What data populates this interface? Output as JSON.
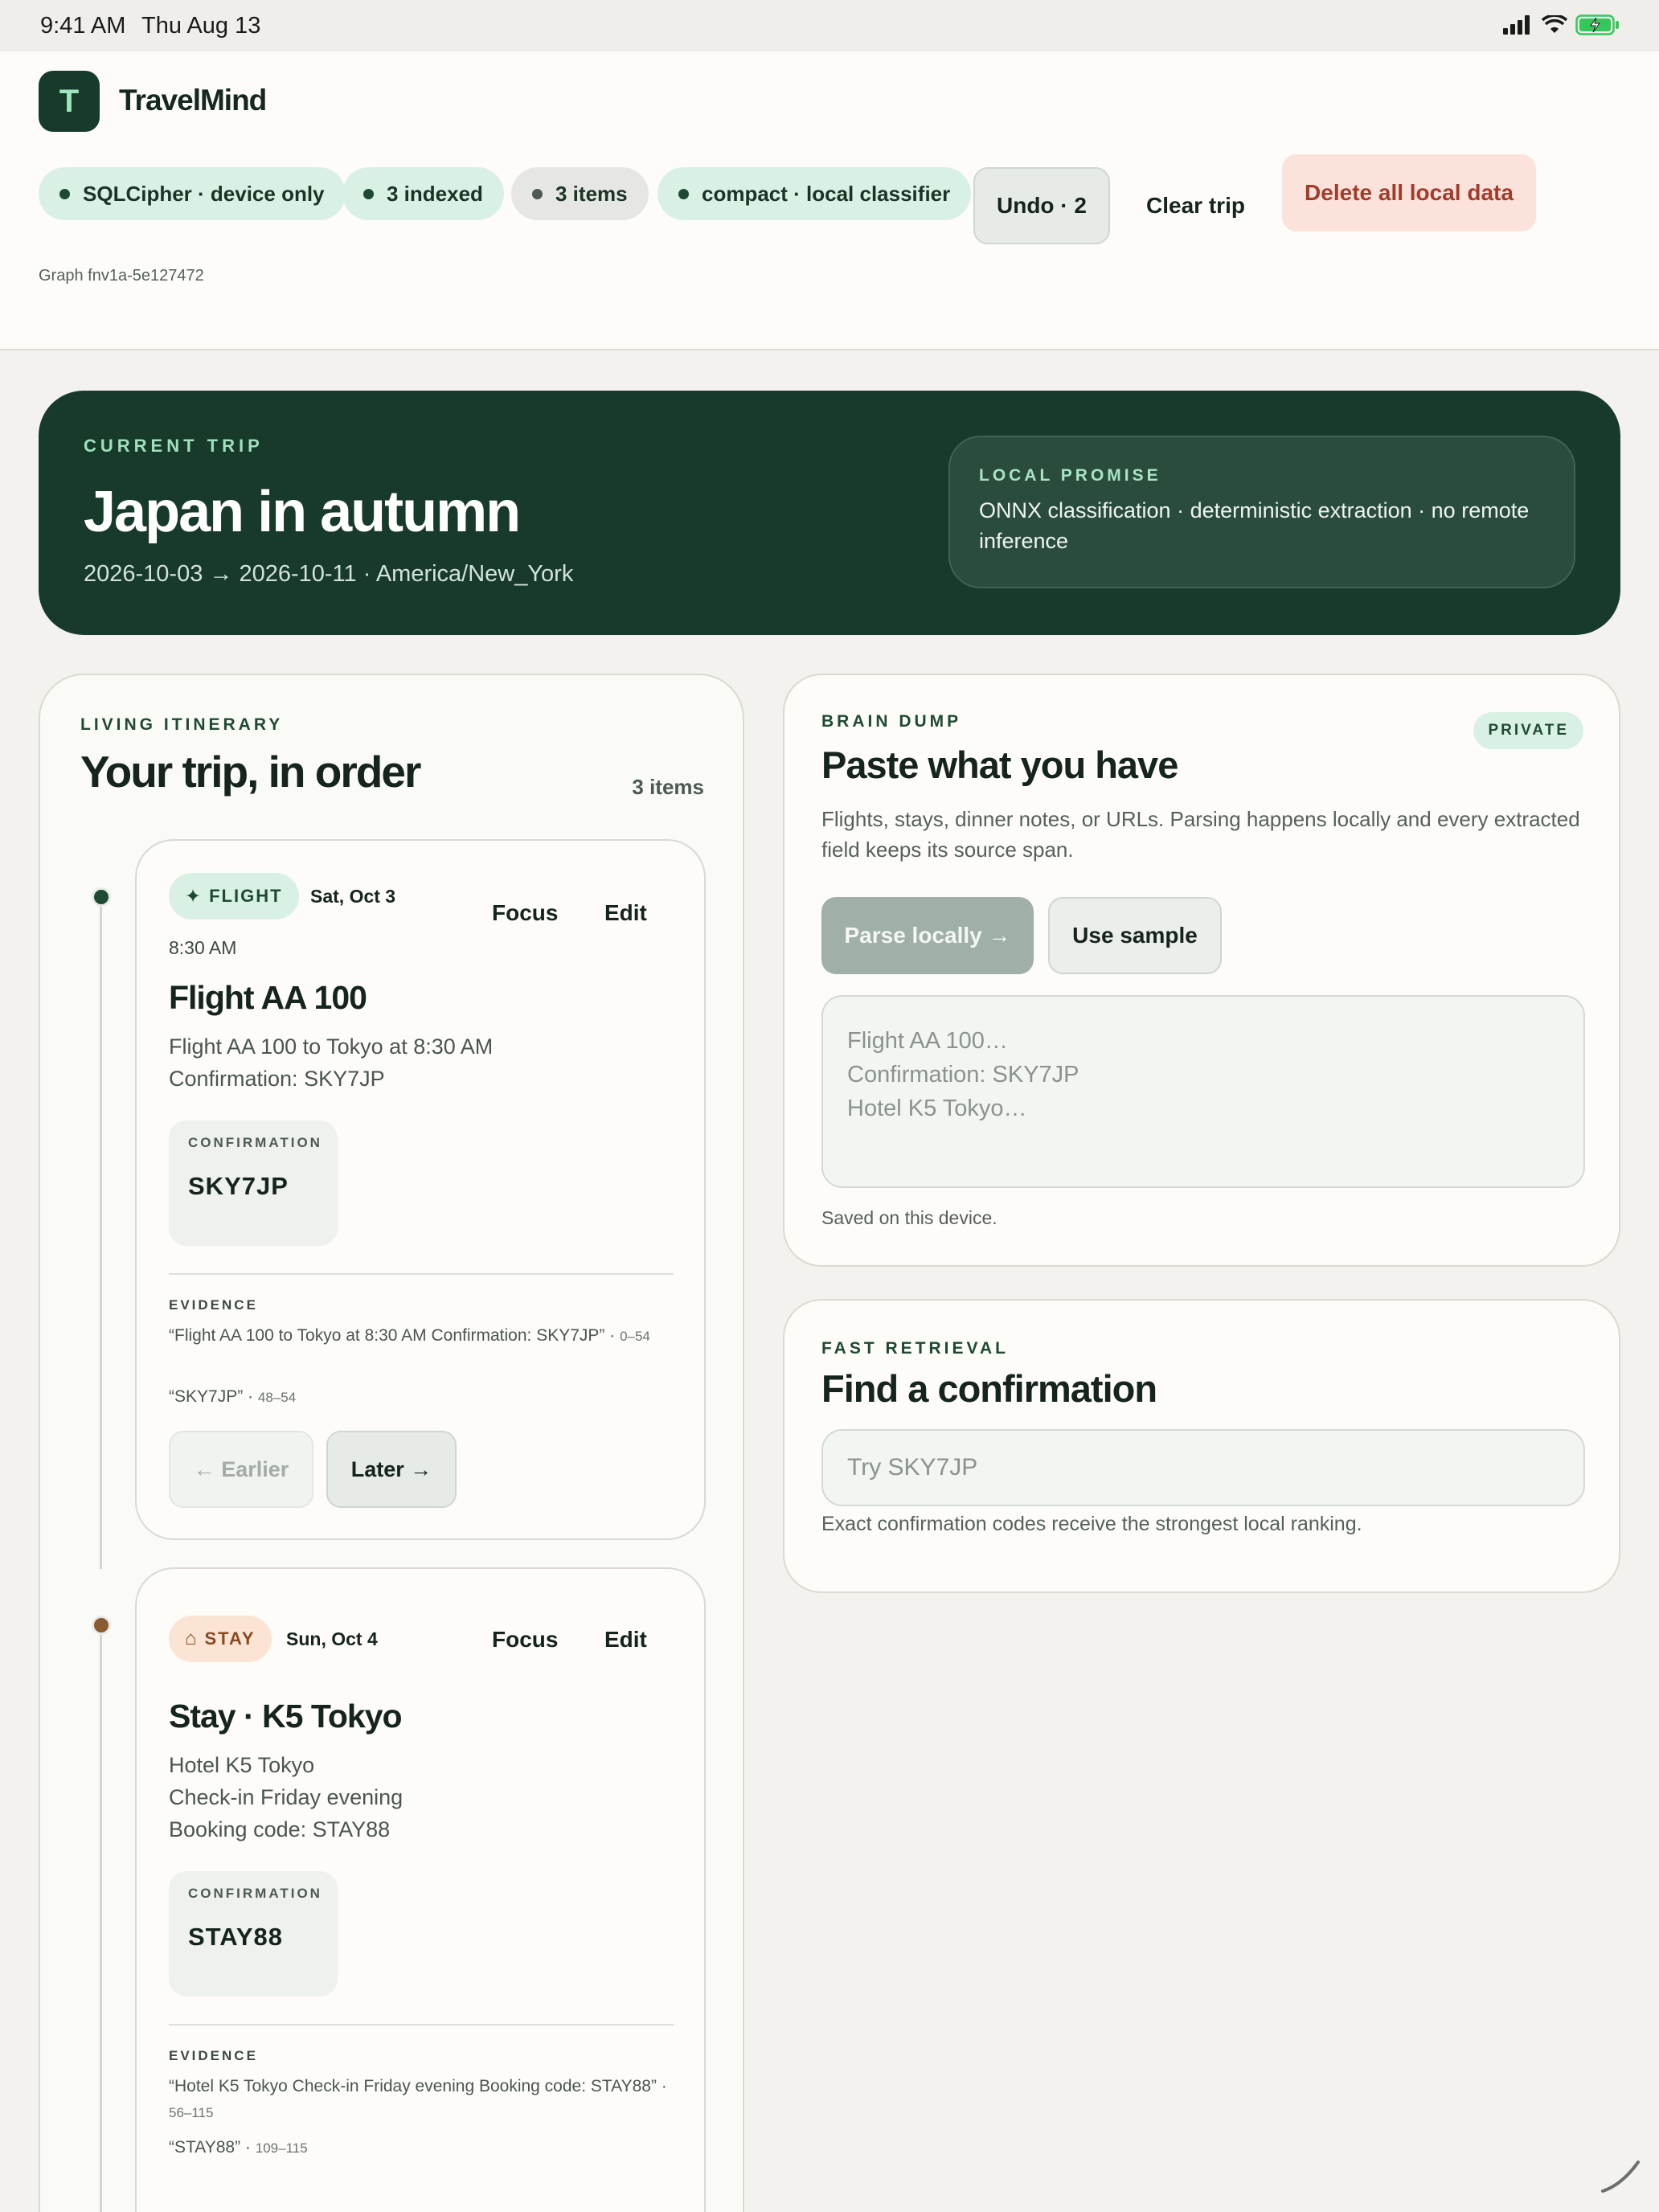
{
  "status_bar": {
    "time": "9:41 AM",
    "date": "Thu Aug 13"
  },
  "app": {
    "logo_letter": "T",
    "name": "TravelMind"
  },
  "chips": [
    {
      "label": "SQLCipher · device only"
    },
    {
      "label": "3 indexed"
    },
    {
      "label": "3 items"
    },
    {
      "label": "compact · local classifier"
    }
  ],
  "actions": {
    "undo": "Undo · 2",
    "clear": "Clear trip",
    "delete": "Delete all local data"
  },
  "graph_id": "Graph fnv1a-5e127472",
  "trip": {
    "eyebrow": "CURRENT TRIP",
    "title": "Japan in autumn",
    "dates": "2026-10-03 → 2026-10-11 · America/New_York",
    "promise_label": "LOCAL PROMISE",
    "promise_text": "ONNX classification · deterministic extraction · no remote inference"
  },
  "itinerary": {
    "eyebrow": "LIVING ITINERARY",
    "heading": "Your trip, in order",
    "count": "3 items",
    "items": [
      {
        "tag": "FLIGHT",
        "tag_icon": "✦",
        "day": "Sat, Oct 3",
        "time": "8:30 AM",
        "focus": "Focus",
        "edit": "Edit",
        "title": "Flight AA 100",
        "desc1": "Flight AA 100 to Tokyo at 8:30 AM",
        "desc2": "Confirmation: SKY7JP",
        "conf_label": "CONFIRMATION",
        "conf_code": "SKY7JP",
        "evidence_label": "EVIDENCE",
        "ev1_text": "“Flight AA 100 to Tokyo at 8:30 AM Confirmation: SKY7JP” ·",
        "ev1_span": "0–54",
        "ev2_text": "“SKY7JP” ·",
        "ev2_span": "48–54",
        "earlier": "← Earlier",
        "later": "Later →"
      },
      {
        "tag": "STAY",
        "tag_icon": "⌂",
        "day": "Sun, Oct 4",
        "focus": "Focus",
        "edit": "Edit",
        "title": "Stay · K5 Tokyo",
        "desc1": "Hotel K5 Tokyo",
        "desc2": "Check-in Friday evening",
        "desc3": "Booking code: STAY88",
        "conf_label": "CONFIRMATION",
        "conf_code": "STAY88",
        "evidence_label": "EVIDENCE",
        "ev1_text": "“Hotel K5 Tokyo Check-in Friday evening Booking code: STAY88” ·",
        "ev1_span": "56–115",
        "ev2_text": "“STAY88” ·",
        "ev2_span": "109–115"
      }
    ]
  },
  "brain_dump": {
    "eyebrow": "BRAIN DUMP",
    "badge": "PRIVATE",
    "heading": "Paste what you have",
    "sub": "Flights, stays, dinner notes, or URLs. Parsing happens locally and every extracted field keeps its source span.",
    "parse": "Parse locally →",
    "sample": "Use sample",
    "placeholder": "Flight AA 100…\nConfirmation: SKY7JP\nHotel K5 Tokyo…",
    "saved": "Saved on this device."
  },
  "retrieval": {
    "eyebrow": "FAST RETRIEVAL",
    "heading": "Find a confirmation",
    "placeholder": "Try SKY7JP",
    "hint": "Exact confirmation codes receive the strongest local ranking."
  },
  "colors": {
    "brand_dark": "#173a2a",
    "accent_green": "#d9f1e4",
    "danger": "#a23b2a",
    "flight_dot": "#1e4a34",
    "stay_dot": "#8a5a30"
  }
}
